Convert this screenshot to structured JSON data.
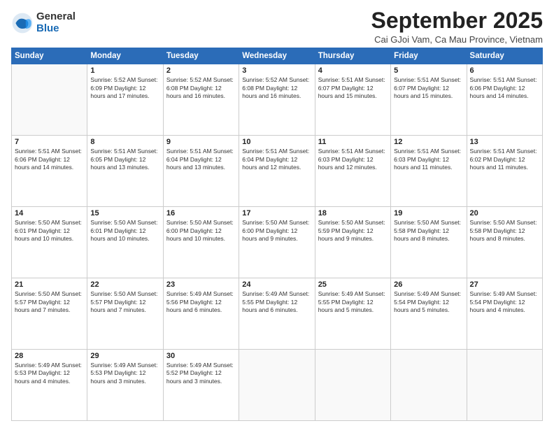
{
  "header": {
    "logo_general": "General",
    "logo_blue": "Blue",
    "month_title": "September 2025",
    "location": "Cai GJoi Vam, Ca Mau Province, Vietnam"
  },
  "days_of_week": [
    "Sunday",
    "Monday",
    "Tuesday",
    "Wednesday",
    "Thursday",
    "Friday",
    "Saturday"
  ],
  "weeks": [
    [
      {
        "num": "",
        "info": ""
      },
      {
        "num": "1",
        "info": "Sunrise: 5:52 AM\nSunset: 6:09 PM\nDaylight: 12 hours\nand 17 minutes."
      },
      {
        "num": "2",
        "info": "Sunrise: 5:52 AM\nSunset: 6:08 PM\nDaylight: 12 hours\nand 16 minutes."
      },
      {
        "num": "3",
        "info": "Sunrise: 5:52 AM\nSunset: 6:08 PM\nDaylight: 12 hours\nand 16 minutes."
      },
      {
        "num": "4",
        "info": "Sunrise: 5:51 AM\nSunset: 6:07 PM\nDaylight: 12 hours\nand 15 minutes."
      },
      {
        "num": "5",
        "info": "Sunrise: 5:51 AM\nSunset: 6:07 PM\nDaylight: 12 hours\nand 15 minutes."
      },
      {
        "num": "6",
        "info": "Sunrise: 5:51 AM\nSunset: 6:06 PM\nDaylight: 12 hours\nand 14 minutes."
      }
    ],
    [
      {
        "num": "7",
        "info": "Sunrise: 5:51 AM\nSunset: 6:06 PM\nDaylight: 12 hours\nand 14 minutes."
      },
      {
        "num": "8",
        "info": "Sunrise: 5:51 AM\nSunset: 6:05 PM\nDaylight: 12 hours\nand 13 minutes."
      },
      {
        "num": "9",
        "info": "Sunrise: 5:51 AM\nSunset: 6:04 PM\nDaylight: 12 hours\nand 13 minutes."
      },
      {
        "num": "10",
        "info": "Sunrise: 5:51 AM\nSunset: 6:04 PM\nDaylight: 12 hours\nand 12 minutes."
      },
      {
        "num": "11",
        "info": "Sunrise: 5:51 AM\nSunset: 6:03 PM\nDaylight: 12 hours\nand 12 minutes."
      },
      {
        "num": "12",
        "info": "Sunrise: 5:51 AM\nSunset: 6:03 PM\nDaylight: 12 hours\nand 11 minutes."
      },
      {
        "num": "13",
        "info": "Sunrise: 5:51 AM\nSunset: 6:02 PM\nDaylight: 12 hours\nand 11 minutes."
      }
    ],
    [
      {
        "num": "14",
        "info": "Sunrise: 5:50 AM\nSunset: 6:01 PM\nDaylight: 12 hours\nand 10 minutes."
      },
      {
        "num": "15",
        "info": "Sunrise: 5:50 AM\nSunset: 6:01 PM\nDaylight: 12 hours\nand 10 minutes."
      },
      {
        "num": "16",
        "info": "Sunrise: 5:50 AM\nSunset: 6:00 PM\nDaylight: 12 hours\nand 10 minutes."
      },
      {
        "num": "17",
        "info": "Sunrise: 5:50 AM\nSunset: 6:00 PM\nDaylight: 12 hours\nand 9 minutes."
      },
      {
        "num": "18",
        "info": "Sunrise: 5:50 AM\nSunset: 5:59 PM\nDaylight: 12 hours\nand 9 minutes."
      },
      {
        "num": "19",
        "info": "Sunrise: 5:50 AM\nSunset: 5:58 PM\nDaylight: 12 hours\nand 8 minutes."
      },
      {
        "num": "20",
        "info": "Sunrise: 5:50 AM\nSunset: 5:58 PM\nDaylight: 12 hours\nand 8 minutes."
      }
    ],
    [
      {
        "num": "21",
        "info": "Sunrise: 5:50 AM\nSunset: 5:57 PM\nDaylight: 12 hours\nand 7 minutes."
      },
      {
        "num": "22",
        "info": "Sunrise: 5:50 AM\nSunset: 5:57 PM\nDaylight: 12 hours\nand 7 minutes."
      },
      {
        "num": "23",
        "info": "Sunrise: 5:49 AM\nSunset: 5:56 PM\nDaylight: 12 hours\nand 6 minutes."
      },
      {
        "num": "24",
        "info": "Sunrise: 5:49 AM\nSunset: 5:55 PM\nDaylight: 12 hours\nand 6 minutes."
      },
      {
        "num": "25",
        "info": "Sunrise: 5:49 AM\nSunset: 5:55 PM\nDaylight: 12 hours\nand 5 minutes."
      },
      {
        "num": "26",
        "info": "Sunrise: 5:49 AM\nSunset: 5:54 PM\nDaylight: 12 hours\nand 5 minutes."
      },
      {
        "num": "27",
        "info": "Sunrise: 5:49 AM\nSunset: 5:54 PM\nDaylight: 12 hours\nand 4 minutes."
      }
    ],
    [
      {
        "num": "28",
        "info": "Sunrise: 5:49 AM\nSunset: 5:53 PM\nDaylight: 12 hours\nand 4 minutes."
      },
      {
        "num": "29",
        "info": "Sunrise: 5:49 AM\nSunset: 5:53 PM\nDaylight: 12 hours\nand 3 minutes."
      },
      {
        "num": "30",
        "info": "Sunrise: 5:49 AM\nSunset: 5:52 PM\nDaylight: 12 hours\nand 3 minutes."
      },
      {
        "num": "",
        "info": ""
      },
      {
        "num": "",
        "info": ""
      },
      {
        "num": "",
        "info": ""
      },
      {
        "num": "",
        "info": ""
      }
    ]
  ]
}
